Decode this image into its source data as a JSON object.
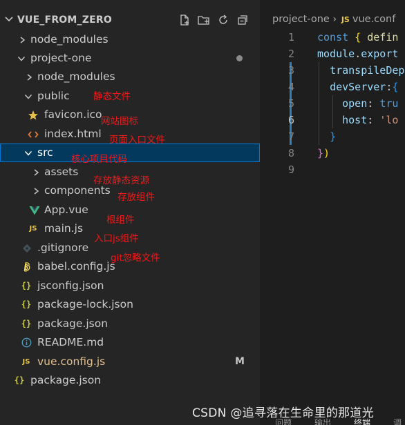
{
  "explorer": {
    "title": "VUE_FROM_ZERO",
    "actions": [
      "new-file-icon",
      "new-folder-icon",
      "refresh-icon",
      "collapse-all-icon"
    ],
    "items": [
      {
        "label": "node_modules",
        "icon": "chevron-right-icon"
      },
      {
        "label": "project-one",
        "icon": "chevron-down-icon"
      },
      {
        "label": "node_modules",
        "icon": "chevron-right-icon"
      },
      {
        "label": "public",
        "icon": "chevron-down-icon"
      },
      {
        "label": "favicon.ico",
        "icon": "star-icon"
      },
      {
        "label": "index.html",
        "icon": "html-icon"
      },
      {
        "label": "src",
        "icon": "chevron-down-icon"
      },
      {
        "label": "assets",
        "icon": "chevron-right-icon"
      },
      {
        "label": "components",
        "icon": "chevron-right-icon"
      },
      {
        "label": "App.vue",
        "icon": "vue-icon"
      },
      {
        "label": "main.js",
        "icon": "js-icon",
        "icon_text": "JS"
      },
      {
        "label": ".gitignore",
        "icon": "git-icon"
      },
      {
        "label": "babel.config.js",
        "icon": "babel-icon"
      },
      {
        "label": "jsconfig.json",
        "icon": "json-icon",
        "icon_text": "{}"
      },
      {
        "label": "package-lock.json",
        "icon": "json-icon",
        "icon_text": "{}"
      },
      {
        "label": "package.json",
        "icon": "json-icon",
        "icon_text": "{}"
      },
      {
        "label": "README.md",
        "icon": "info-icon"
      },
      {
        "label": "vue.config.js",
        "icon": "js-icon",
        "icon_text": "JS",
        "status": "M"
      },
      {
        "label": "package.json",
        "icon": "json-icon",
        "icon_text": "{}"
      }
    ],
    "annotations": [
      "静态文件",
      "网站图标",
      "页面入口文件",
      "核心项目代码",
      "存放静态资源",
      "存放组件",
      "根组件",
      "入口js组件",
      "git忽略文件"
    ]
  },
  "editor": {
    "breadcrumb": {
      "folder": "project-one",
      "sep": "›",
      "file_icon": "JS",
      "file": "vue.conf"
    },
    "lines": [
      {
        "n": "1",
        "segs": [
          [
            "kw",
            "const "
          ],
          [
            "br1",
            "{ "
          ],
          [
            "fn",
            "defin"
          ]
        ]
      },
      {
        "n": "2",
        "segs": [
          [
            "prop",
            "module"
          ],
          [
            "pl",
            "."
          ],
          [
            "prop",
            "export"
          ]
        ]
      },
      {
        "n": "3",
        "segs": [
          [
            "pl",
            "  "
          ],
          [
            "prop",
            "transpileDep"
          ]
        ]
      },
      {
        "n": "4",
        "segs": [
          [
            "pl",
            "  "
          ],
          [
            "prop",
            "devServer"
          ],
          [
            "pl",
            ":"
          ],
          [
            "br3",
            "{"
          ]
        ]
      },
      {
        "n": "5",
        "segs": [
          [
            "pl",
            "    "
          ],
          [
            "prop",
            "open"
          ],
          [
            "pl",
            ": "
          ],
          [
            "kw",
            "tru"
          ]
        ]
      },
      {
        "n": "6",
        "segs": [
          [
            "pl",
            "    "
          ],
          [
            "prop",
            "host"
          ],
          [
            "pl",
            ": "
          ],
          [
            "str",
            "'lo"
          ]
        ]
      },
      {
        "n": "7",
        "segs": [
          [
            "pl",
            "  "
          ],
          [
            "br3",
            "}"
          ]
        ]
      },
      {
        "n": "8",
        "segs": [
          [
            "br2",
            "}"
          ],
          [
            "br1",
            ")"
          ]
        ]
      },
      {
        "n": "9",
        "segs": []
      }
    ],
    "active_line": "6"
  },
  "panel_tabs": [
    "问题",
    "输出",
    "终端",
    "调"
  ],
  "watermark": "CSDN @追寻落在生命里的那道光",
  "colors": {
    "annotation": "#f01a1a",
    "selection": "#04395e",
    "accent": "#0078d4"
  }
}
